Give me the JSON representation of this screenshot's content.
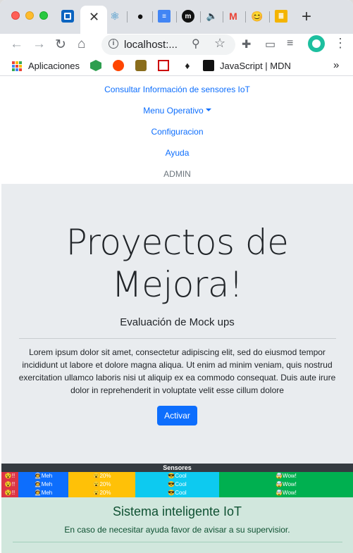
{
  "browser": {
    "address": "localhost:...",
    "bookmarks": {
      "apps_label": "Aplicaciones",
      "mdn_label": "JavaScript | MDN",
      "more": "»"
    }
  },
  "nav": {
    "item1": "Consultar Información de sensores IoT",
    "item2": "Menu Operativo",
    "item3": "Configuracion",
    "item4": "Ayuda",
    "item5": "ADMIN"
  },
  "hero": {
    "title": "Proyectos de Mejora!",
    "subtitle": "Evaluación de Mock ups",
    "body": "Lorem ipsum dolor sit amet, consectetur adipiscing elit, sed do eiusmod tempor incididunt ut labore et dolore magna aliqua. Ut enim ad minim veniam, quis nostrud exercitation ullamco laboris nisi ut aliquip ex ea commodo consequat. Duis aute irure dolor in reprehenderit in voluptate velit esse cillum dolore",
    "button": "Activar"
  },
  "sensors": {
    "header": "Sensores",
    "columns": [
      {
        "text": "😵!!",
        "color": "#dc3545"
      },
      {
        "text": "🧑‍🚀Meh",
        "color": "#0d6efd"
      },
      {
        "text": "😮20%",
        "color": "#ffc107"
      },
      {
        "text": "😎Cool",
        "color": "#0dcaf0"
      },
      {
        "text": "🤯Wow!",
        "color": "#00b050"
      }
    ]
  },
  "footer": {
    "title": "Sistema inteligente IoT",
    "text": "En caso de necesitar ayuda favor de avisar a su supervisior."
  }
}
